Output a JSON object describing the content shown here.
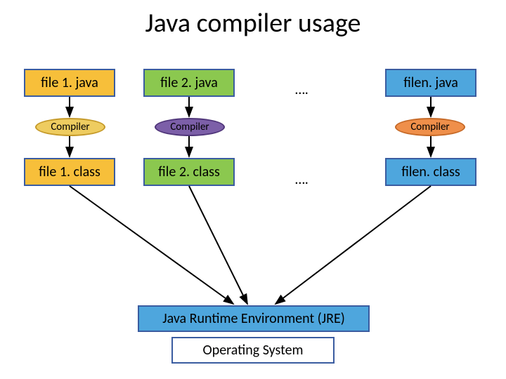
{
  "title": "Java compiler usage",
  "sources": {
    "f1": "file 1. java",
    "f2": "file 2. java",
    "fn": "filen. java",
    "dots": "…."
  },
  "compilers": {
    "c1": "Compiler",
    "c2": "Compiler",
    "cn": "Compiler"
  },
  "classes": {
    "f1": "file 1. class",
    "f2": "file 2. class",
    "fn": "filen. class",
    "dots": "…."
  },
  "jre": "Java Runtime Environment (JRE)",
  "os": "Operating System",
  "colors": {
    "border": "#3a5ca0",
    "orange": "#f7bf3a",
    "green": "#8bc84f",
    "blue": "#4ea6dd",
    "ellipse1": "#eecc60",
    "ellipse2": "#7c5fa8",
    "ellipseN": "#ef8f4a"
  },
  "chart_data": {
    "type": "diagram",
    "nodes": [
      {
        "id": "src1",
        "label": "file 1. java",
        "kind": "source"
      },
      {
        "id": "src2",
        "label": "file 2. java",
        "kind": "source"
      },
      {
        "id": "srcn",
        "label": "filen. java",
        "kind": "source"
      },
      {
        "id": "c1",
        "label": "Compiler",
        "kind": "compiler"
      },
      {
        "id": "c2",
        "label": "Compiler",
        "kind": "compiler"
      },
      {
        "id": "cn",
        "label": "Compiler",
        "kind": "compiler"
      },
      {
        "id": "cls1",
        "label": "file 1. class",
        "kind": "class"
      },
      {
        "id": "cls2",
        "label": "file 2. class",
        "kind": "class"
      },
      {
        "id": "clsn",
        "label": "filen. class",
        "kind": "class"
      },
      {
        "id": "jre",
        "label": "Java Runtime Environment (JRE)",
        "kind": "runtime"
      },
      {
        "id": "os",
        "label": "Operating System",
        "kind": "os"
      }
    ],
    "edges": [
      {
        "from": "src1",
        "to": "c1"
      },
      {
        "from": "src2",
        "to": "c2"
      },
      {
        "from": "srcn",
        "to": "cn"
      },
      {
        "from": "c1",
        "to": "cls1"
      },
      {
        "from": "c2",
        "to": "cls2"
      },
      {
        "from": "cn",
        "to": "clsn"
      },
      {
        "from": "cls1",
        "to": "jre"
      },
      {
        "from": "cls2",
        "to": "jre"
      },
      {
        "from": "clsn",
        "to": "jre"
      },
      {
        "from": "jre",
        "to": "os"
      }
    ]
  }
}
